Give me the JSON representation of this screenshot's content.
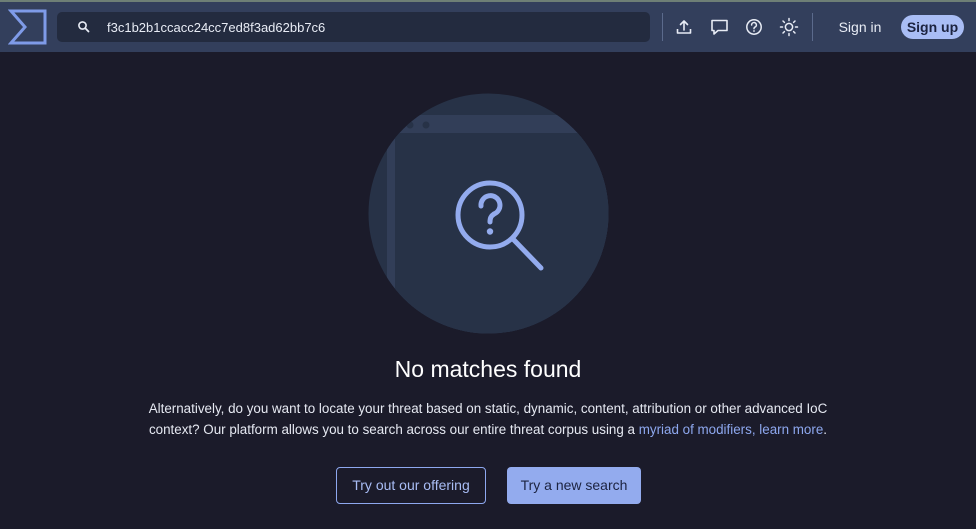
{
  "header": {
    "search": {
      "value": "f3c1b2b1ccacc24cc7ed8f3ad62bb7c6",
      "placeholder": ""
    },
    "icons": [
      "upload-icon",
      "comment-icon",
      "help-icon",
      "theme-sun-icon"
    ],
    "sign_in_label": "Sign in",
    "sign_up_label": "Sign up"
  },
  "main": {
    "title": "No matches found",
    "description_part1": "Alternatively, do you want to locate your threat based on static, dynamic, content, attribution or other advanced IoC context? Our platform allows you to search across our entire threat corpus using a ",
    "description_link": "myriad of modifiers, learn more",
    "description_end": ".",
    "offering_button_label": "Try out our offering",
    "new_search_button_label": "Try a new search"
  },
  "colors": {
    "background": "#1b1b2a",
    "header": "#333f5c",
    "accent": "#93abee",
    "link": "#8ea8ef"
  }
}
